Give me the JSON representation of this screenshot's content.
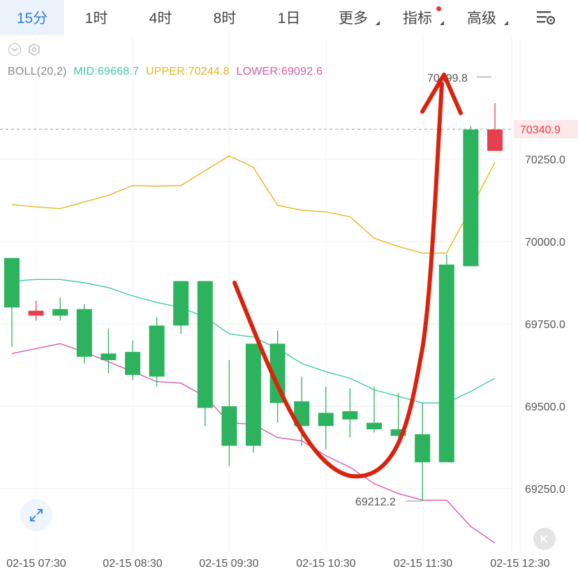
{
  "tabs": [
    {
      "label": "15分",
      "active": true
    },
    {
      "label": "1时"
    },
    {
      "label": "4时"
    },
    {
      "label": "8时"
    },
    {
      "label": "1日"
    },
    {
      "label": "更多",
      "caret": true
    },
    {
      "label": "指标",
      "caret": true,
      "dot": true
    },
    {
      "label": "高级",
      "caret": true
    }
  ],
  "indicator": {
    "name": "BOLL(20,2)",
    "mid": "MID:69668.7",
    "upper": "UPPER:70244.8",
    "lower": "LOWER:69092.6"
  },
  "colors": {
    "up": "#2db35d",
    "down": "#e5404f",
    "mid": "#3ec9a7",
    "upper": "#e6b422",
    "lower": "#d85aa8",
    "accent": "#2f7fd8",
    "arrow": "#d9230f"
  },
  "icons": [
    "eye-icon",
    "settings-icon",
    "chart-menu-icon",
    "expand-icon",
    "back-icon"
  ],
  "chart_data": {
    "type": "candlestick",
    "ylim": [
      69150,
      70620
    ],
    "y_ticks": [
      "70250.0",
      "70000.0",
      "69750.0",
      "69500.0",
      "69250.0"
    ],
    "x_ticks": [
      "02-15 07:30",
      "02-15 08:30",
      "02-15 09:30",
      "02-15 10:30",
      "02-15 11:30",
      "02-15 12:30"
    ],
    "current_price": "70340.9",
    "current_price_value": 70340.9,
    "max_label": "70499.8",
    "max_label_value": 70499.8,
    "min_label": "69212.2",
    "min_label_value": 69212.2,
    "candles": [
      {
        "o": 69800,
        "h": 69900,
        "l": 69680,
        "c": 69950
      },
      {
        "o": 69790,
        "h": 69820,
        "l": 69760,
        "c": 69775
      },
      {
        "o": 69775,
        "h": 69830,
        "l": 69760,
        "c": 69795
      },
      {
        "o": 69650,
        "h": 69810,
        "l": 69630,
        "c": 69795
      },
      {
        "o": 69640,
        "h": 69735,
        "l": 69600,
        "c": 69660
      },
      {
        "o": 69595,
        "h": 69700,
        "l": 69580,
        "c": 69665
      },
      {
        "o": 69590,
        "h": 69770,
        "l": 69560,
        "c": 69745
      },
      {
        "o": 69745,
        "h": 69880,
        "l": 69720,
        "c": 69880
      },
      {
        "o": 69495,
        "h": 69880,
        "l": 69440,
        "c": 69880
      },
      {
        "o": 69380,
        "h": 69640,
        "l": 69320,
        "c": 69500
      },
      {
        "o": 69380,
        "h": 69690,
        "l": 69360,
        "c": 69690
      },
      {
        "o": 69510,
        "h": 69730,
        "l": 69450,
        "c": 69690
      },
      {
        "o": 69440,
        "h": 69590,
        "l": 69380,
        "c": 69515
      },
      {
        "o": 69440,
        "h": 69560,
        "l": 69370,
        "c": 69480
      },
      {
        "o": 69460,
        "h": 69555,
        "l": 69405,
        "c": 69485
      },
      {
        "o": 69430,
        "h": 69560,
        "l": 69420,
        "c": 69450
      },
      {
        "o": 69410,
        "h": 69540,
        "l": 69405,
        "c": 69430
      },
      {
        "o": 69330,
        "h": 69510,
        "l": 69212.2,
        "c": 69415
      },
      {
        "o": 69330,
        "h": 69960,
        "l": 69330,
        "c": 69930
      },
      {
        "o": 69925,
        "h": 70350,
        "l": 69925,
        "c": 70340
      },
      {
        "o": 70340,
        "h": 70420,
        "l": 70320,
        "c": 70275
      }
    ],
    "mid": [
      69880,
      69885,
      69885,
      69875,
      69860,
      69835,
      69815,
      69800,
      69770,
      69720,
      69710,
      69675,
      69630,
      69605,
      69585,
      69550,
      69530,
      69510,
      69510,
      69545,
      69585
    ],
    "upper": [
      70112,
      70105,
      70100,
      70120,
      70140,
      70170,
      70168,
      70170,
      70215,
      70260,
      70225,
      70110,
      70095,
      70090,
      70075,
      70010,
      69985,
      69965,
      69965,
      70100,
      70240
    ],
    "lower": [
      69660,
      69675,
      69690,
      69665,
      69635,
      69605,
      69575,
      69570,
      69530,
      69450,
      69445,
      69405,
      69395,
      69350,
      69315,
      69265,
      69235,
      69215,
      69215,
      69135,
      69085
    ]
  }
}
